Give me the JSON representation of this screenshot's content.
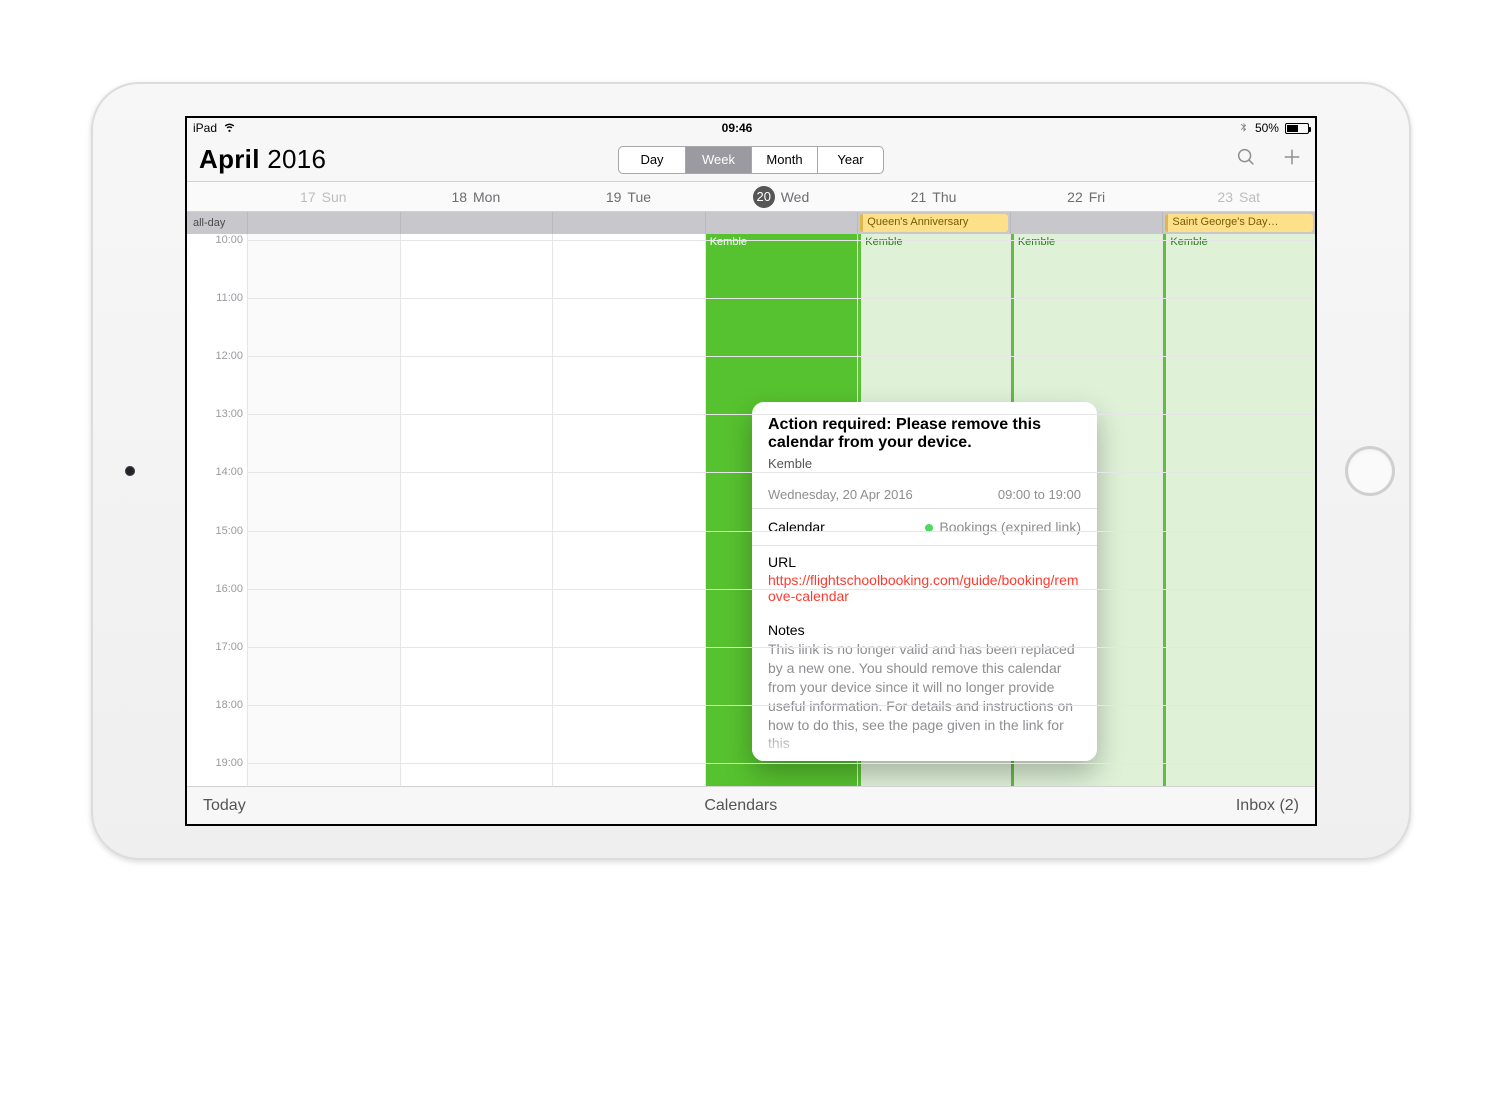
{
  "status": {
    "carrier": "iPad",
    "time": "09:46",
    "battery_pct": "50%"
  },
  "header": {
    "month": "April",
    "year": "2016",
    "segments": {
      "day": "Day",
      "week": "Week",
      "month": "Month",
      "year": "Year",
      "selected": "week"
    }
  },
  "days": [
    {
      "num": "17",
      "dow": "Sun",
      "weekend": true
    },
    {
      "num": "18",
      "dow": "Mon"
    },
    {
      "num": "19",
      "dow": "Tue"
    },
    {
      "num": "20",
      "dow": "Wed",
      "today": true
    },
    {
      "num": "21",
      "dow": "Thu"
    },
    {
      "num": "22",
      "dow": "Fri"
    },
    {
      "num": "23",
      "dow": "Sat",
      "weekend": true
    }
  ],
  "allday": {
    "label": "all-day",
    "thu": "Queen's Anniversary",
    "sat": "Saint George's Day…"
  },
  "hours": [
    "10:00",
    "11:00",
    "12:00",
    "13:00",
    "14:00",
    "15:00",
    "16:00",
    "17:00",
    "18:00",
    "19:00"
  ],
  "column_event_label": "Kemble",
  "popover": {
    "title": "Action required: Please remove this calendar from your device.",
    "location": "Kemble",
    "date": "Wednesday, 20 Apr 2016",
    "time": "09:00 to 19:00",
    "calendar_label": "Calendar",
    "calendar_name": "Bookings (expired link)",
    "url_label": "URL",
    "url": "https://flightschoolbooking.com/guide/booking/remove-calendar",
    "notes_label": "Notes",
    "notes_body": "This link is no longer valid and has been replaced by a new one. You should remove this calendar from your device since it will no longer provide useful information. For details and instructions on how to do this, see the page given in the link for this"
  },
  "toolbar": {
    "today": "Today",
    "calendars": "Calendars",
    "inbox": "Inbox (2)"
  }
}
